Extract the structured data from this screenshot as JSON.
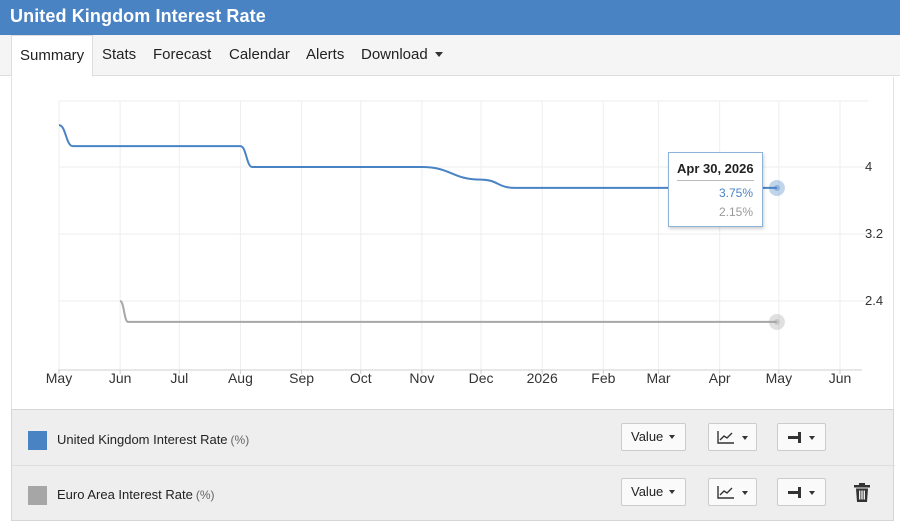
{
  "page_title": "United Kingdom Interest Rate",
  "tabs": [
    {
      "label": "Summary",
      "active": true
    },
    {
      "label": "Stats"
    },
    {
      "label": "Forecast"
    },
    {
      "label": "Calendar"
    },
    {
      "label": "Alerts"
    },
    {
      "label": "Download",
      "dropdown": true
    }
  ],
  "chart_data": {
    "type": "line",
    "x_axis": {
      "type": "date",
      "range": [
        "2025-05-01",
        "2026-06-01"
      ],
      "tick_labels": [
        "May",
        "Jun",
        "Jul",
        "Aug",
        "Sep",
        "Oct",
        "Nov",
        "Dec",
        "2026",
        "Feb",
        "Mar",
        "Apr",
        "May",
        "Jun"
      ],
      "tick_dates": [
        "2025-05-01",
        "2025-06-01",
        "2025-07-01",
        "2025-08-01",
        "2025-09-01",
        "2025-10-01",
        "2025-11-01",
        "2025-12-01",
        "2026-01-01",
        "2026-02-01",
        "2026-03-01",
        "2026-04-01",
        "2026-05-01",
        "2026-06-01"
      ]
    },
    "y_axis": {
      "position": "right",
      "ticks": [
        2.4,
        3.2,
        4
      ],
      "range": [
        1.7,
        4.8
      ]
    },
    "grid": true,
    "series": [
      {
        "name": "United Kingdom Interest Rate",
        "unit": "%",
        "color": "#4a83c4",
        "points": [
          [
            "2025-05-01",
            4.5
          ],
          [
            "2025-05-08",
            4.25
          ],
          [
            "2025-08-01",
            4.25
          ],
          [
            "2025-08-07",
            4.0
          ],
          [
            "2025-11-01",
            4.0
          ],
          [
            "2025-12-01",
            3.85
          ],
          [
            "2025-12-18",
            3.75
          ],
          [
            "2026-04-30",
            3.75
          ]
        ]
      },
      {
        "name": "Euro Area Interest Rate",
        "unit": "%",
        "color": "#a6a6a6",
        "points": [
          [
            "2025-06-01",
            2.4
          ],
          [
            "2025-06-05",
            2.15
          ],
          [
            "2026-04-30",
            2.15
          ]
        ]
      }
    ],
    "tooltip": {
      "date": "Apr 30, 2026",
      "values": [
        "3.75%",
        "2.15%"
      ]
    }
  },
  "legend": [
    {
      "name": "United Kingdom Interest Rate",
      "unit": "(%)",
      "color": "#4a83c4",
      "value_label": "Value",
      "trash": false
    },
    {
      "name": "Euro Area Interest Rate",
      "unit": "(%)",
      "color": "#a6a6a6",
      "value_label": "Value",
      "trash": true
    }
  ],
  "icons": {
    "chart_type": "line-chart-icon",
    "axis_side": "axis-right-icon",
    "delete": "trash-icon"
  }
}
